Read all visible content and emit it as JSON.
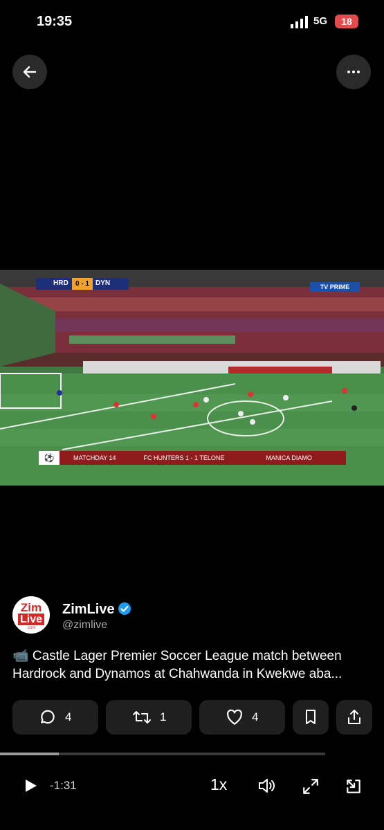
{
  "status_bar": {
    "time": "19:35",
    "network": "5G",
    "battery": "18"
  },
  "video": {
    "scoreboard": {
      "home": "HRD",
      "score": "0 - 1",
      "away": "DYN"
    },
    "channel": "TV PRIME",
    "ticker": {
      "matchday": "MATCHDAY 14",
      "fixture": "FC HUNTERS  1 - 1  TELONE",
      "next": "MANICA DIAMO"
    }
  },
  "post": {
    "author_name": "ZimLive",
    "author_handle": "@zimlive",
    "avatar_text_top": "Zim",
    "avatar_text_bottom": "Live",
    "avatar_text_small": ".com",
    "text_line1": "📹 Castle Lager Premier Soccer League match between",
    "text_line2": "Hardrock and Dynamos at Chahwanda in Kwekwe aba..."
  },
  "actions": {
    "replies": "4",
    "reposts": "1",
    "likes": "4"
  },
  "player": {
    "remaining": "-1:31",
    "speed": "1x",
    "progress": 0.18
  }
}
